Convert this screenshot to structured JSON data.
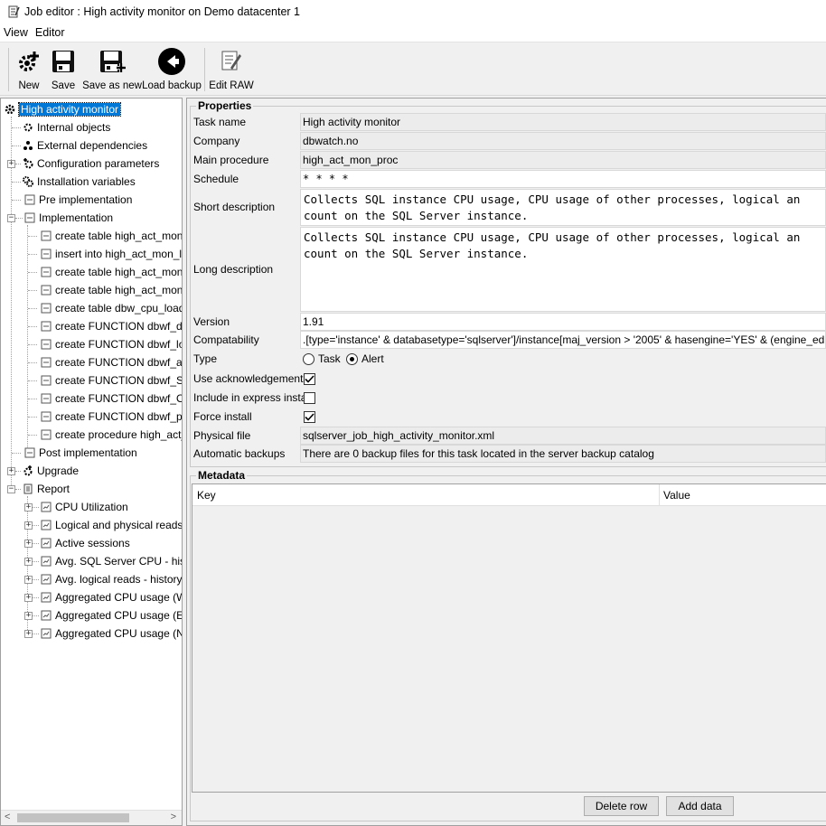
{
  "window": {
    "title": "Job editor : High activity monitor on Demo datacenter 1"
  },
  "menu": [
    "View",
    "Editor"
  ],
  "toolbar": {
    "new": "New",
    "save": "Save",
    "save_as_new": "Save as new",
    "load_backup": "Load backup",
    "edit_raw": "Edit RAW"
  },
  "tree": {
    "root": "High activity monitor",
    "internal_objects": "Internal objects",
    "external_dependencies": "External dependencies",
    "configuration_parameters": "Configuration parameters",
    "installation_variables": "Installation variables",
    "pre_implementation": "Pre implementation",
    "implementation": "Implementation",
    "implementation_items": [
      "create table high_act_mon_l",
      "insert into  high_act_mon_la",
      "create table high_act_mon_t",
      "create table high_act_mon_t",
      "create table dbw_cpu_load_",
      "create FUNCTION dbwf_dat",
      "create FUNCTION dbwf_logi",
      "create FUNCTION dbwf_acti",
      "create FUNCTION dbwf_SQL",
      "create FUNCTION dbwf_Oth",
      "create FUNCTION dbwf_phy",
      "create procedure high_act_r"
    ],
    "post_implementation": "Post implementation",
    "upgrade": "Upgrade",
    "report": "Report",
    "report_items": [
      "CPU Utilization",
      "Logical and physical reads",
      "Active sessions",
      "Avg. SQL Server CPU - histo",
      "Avg. logical reads - history '",
      "Aggregated CPU usage (WH",
      "Aggregated CPU usage (EH)",
      "Aggregated CPU usage (NH)"
    ]
  },
  "properties": {
    "title": "Properties",
    "task_name_label": "Task name",
    "task_name": "High activity monitor",
    "company_label": "Company",
    "company": "dbwatch.no",
    "main_procedure_label": "Main procedure",
    "main_procedure": "high_act_mon_proc",
    "schedule_label": "Schedule",
    "schedule": "* * * *",
    "short_description_label": "Short description",
    "short_description": "Collects SQL instance CPU usage, CPU usage of other processes, logical an\ncount on the SQL Server instance.",
    "long_description_label": "Long description",
    "long_description": "Collects SQL instance CPU usage, CPU usage of other processes, logical an\ncount on the SQL Server instance.",
    "version_label": "Version",
    "version": "1.91",
    "compatability_label": "Compatability",
    "compatability": ".[type='instance' & databasetype='sqlserver']/instance[maj_version > '2005' & hasengine='YES' & (engine_edition = 'Mic",
    "type_label": "Type",
    "type_task": "Task",
    "type_alert": "Alert",
    "type_selected": "Alert",
    "use_ack_label": "Use acknowledgements",
    "use_ack": true,
    "express_label": "Include in express install",
    "express": false,
    "force_label": "Force install",
    "force": true,
    "physical_file_label": "Physical file",
    "physical_file": "sqlserver_job_high_activity_monitor.xml",
    "auto_backups_label": "Automatic backups",
    "auto_backups": "There are 0 backup files for this task located in the server backup catalog"
  },
  "metadata": {
    "title": "Metadata",
    "col_key": "Key",
    "col_value": "Value",
    "rows": [],
    "delete_row": "Delete row",
    "add_data": "Add data"
  },
  "colors": {
    "selection": "#0078d7",
    "panel": "#f0f0f0"
  }
}
